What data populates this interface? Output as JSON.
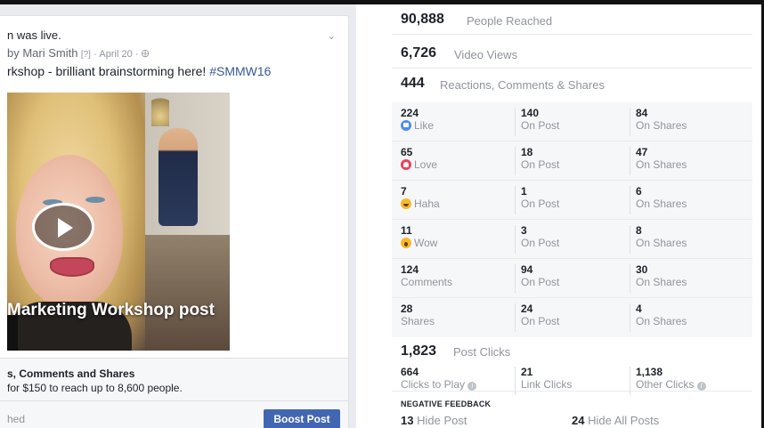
{
  "post": {
    "header_text": "n was live.",
    "author": "by Mari Smith",
    "info_mark": "[?]",
    "date": "· April 20 · ",
    "globe": "🜨",
    "text": "rkshop - brilliant brainstorming here! ",
    "hashtag": "#SMMW16",
    "video_title": "Marketing Workshop post",
    "boost_title": "s, Comments and Shares",
    "boost_line": " for $150 to reach up to 8,600 people.",
    "reached_label": "hed",
    "boost_button": "Boost Post",
    "chevron": "⌄"
  },
  "insights": {
    "people_reached": {
      "value": "90,888",
      "label": "People Reached"
    },
    "video_views": {
      "value": "6,726",
      "label": "Video Views"
    },
    "engagement": {
      "value": "444",
      "label": "Reactions, Comments & Shares"
    },
    "rows": [
      {
        "total": "224",
        "type": "Like",
        "icon": "like-icon",
        "on_post": "140",
        "on_shares": "84"
      },
      {
        "total": "65",
        "type": "Love",
        "icon": "love-icon",
        "on_post": "18",
        "on_shares": "47"
      },
      {
        "total": "7",
        "type": "Haha",
        "icon": "haha-icon",
        "on_post": "1",
        "on_shares": "6"
      },
      {
        "total": "11",
        "type": "Wow",
        "icon": "wow-icon",
        "on_post": "3",
        "on_shares": "8"
      },
      {
        "total": "124",
        "type": "Comments",
        "icon": "",
        "on_post": "94",
        "on_shares": "30"
      },
      {
        "total": "28",
        "type": "Shares",
        "icon": "",
        "on_post": "24",
        "on_shares": "4"
      }
    ],
    "on_post_label": "On Post",
    "on_shares_label": "On Shares",
    "post_clicks": {
      "value": "1,823",
      "label": "Post Clicks"
    },
    "clicks": {
      "play": {
        "value": "664",
        "label": "Clicks to Play"
      },
      "link": {
        "value": "21",
        "label": "Link Clicks"
      },
      "other": {
        "value": "1,138",
        "label": "Other Clicks"
      }
    },
    "negative_heading": "NEGATIVE FEEDBACK",
    "hide_post": {
      "value": "13",
      "label": "Hide Post"
    },
    "hide_all": {
      "value": "24",
      "label": "Hide All Posts"
    }
  }
}
